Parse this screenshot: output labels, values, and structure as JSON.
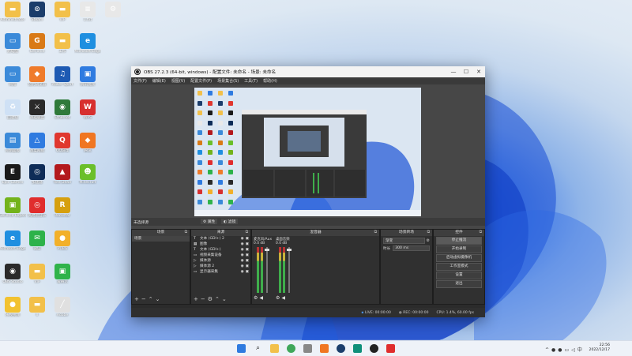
{
  "desktop": {
    "icons": [
      {
        "label": "Administrator",
        "color": "#f2c04a",
        "glyph": "▬"
      },
      {
        "label": "Steam",
        "color": "#1b3d6b",
        "glyph": "⊙"
      },
      {
        "label": "VIP",
        "color": "#f2c04a",
        "glyph": "▬"
      },
      {
        "label": "1.txt",
        "color": "#e8e8e8",
        "glyph": "≡"
      },
      {
        "label": "",
        "color": "#e8e8e8",
        "glyph": "⚙"
      },
      {
        "label": "此电脑",
        "color": "#3b8ad9",
        "glyph": "▭"
      },
      {
        "label": "GeForce",
        "color": "#d97a17",
        "glyph": "G"
      },
      {
        "label": "工作",
        "color": "#f2c04a",
        "glyph": "▬"
      },
      {
        "label": "Microsoft Edge",
        "color": "#1f8fe0",
        "glyph": "e"
      },
      {
        "label": "网络",
        "color": "#3b8ad9",
        "glyph": "▭"
      },
      {
        "label": "猎豹浏览器",
        "color": "#ef7b2b",
        "glyph": "◆"
      },
      {
        "label": "Power Sport",
        "color": "#1d5ab3",
        "glyph": "♫"
      },
      {
        "label": "腾讯视频",
        "color": "#2f7be0",
        "glyph": "▣"
      },
      {
        "label": "回收站",
        "color": "#cfe1f5",
        "glyph": "♻"
      },
      {
        "label": "英雄联盟",
        "color": "#2a2a2a",
        "glyph": "⚔"
      },
      {
        "label": "Ethernet",
        "color": "#2f7a3a",
        "glyph": "◉"
      },
      {
        "label": "WPS",
        "color": "#d7302f",
        "glyph": "W"
      },
      {
        "label": "控制面板",
        "color": "#3b8ad9",
        "glyph": "▤"
      },
      {
        "label": "百度网盘",
        "color": "#2f7be0",
        "glyph": "△"
      },
      {
        "label": "QQ游戏",
        "color": "#e0372f",
        "glyph": "Q"
      },
      {
        "label": "腾讯",
        "color": "#f07622",
        "glyph": "◆"
      },
      {
        "label": "Epic Games",
        "color": "#1a1a1a",
        "glyph": "E"
      },
      {
        "label": "加速器",
        "color": "#0e2c57",
        "glyph": "◎"
      },
      {
        "label": "Red Dead",
        "color": "#b3191d",
        "glyph": "▲"
      },
      {
        "label": "Minecraft",
        "color": "#6bbf2a",
        "glyph": "☻"
      },
      {
        "label": "GeForce Experience",
        "color": "#73b31b",
        "glyph": "▣"
      },
      {
        "label": "网易云音乐",
        "color": "#e02d2d",
        "glyph": "◎"
      },
      {
        "label": "Rockstar",
        "color": "#d6a00f",
        "glyph": "R"
      },
      {
        "label": "Microsoft Edge",
        "color": "#1f8fe0",
        "glyph": "e"
      },
      {
        "label": "微信",
        "color": "#2db24a",
        "glyph": "✉"
      },
      {
        "label": "PUBG",
        "color": "#f2b02a",
        "glyph": "●"
      },
      {
        "label": "OBS Studio",
        "color": "#2a2a2a",
        "glyph": "◉"
      },
      {
        "label": "VIP",
        "color": "#f2c04a",
        "glyph": "▬"
      },
      {
        "label": "爱奇艺",
        "color": "#2fb34a",
        "glyph": "▣"
      },
      {
        "label": "乐视视频",
        "color": "#f2c230",
        "glyph": "●"
      },
      {
        "label": "II",
        "color": "#f2c04a",
        "glyph": "▬"
      },
      {
        "label": "Adobe",
        "color": "#e0e0e0",
        "glyph": "╱"
      }
    ]
  },
  "window": {
    "title": "OBS 27.2.3 (64-bit, windows) - 配置文件: 未命名 - 场景: 未命名",
    "menu": [
      "文件(F)",
      "编辑(E)",
      "视图(V)",
      "配置文件(P)",
      "场景集合(S)",
      "工具(T)",
      "帮助(H)"
    ],
    "minimize": "—",
    "maximize": "☐",
    "close": "✕"
  },
  "controls_strip": {
    "left": "未选择源",
    "props": "属性",
    "filters": "滤镜"
  },
  "docks": {
    "scenes": {
      "header": "场景",
      "items": [
        "场景"
      ]
    },
    "sources": {
      "header": "来源",
      "items": [
        {
          "label": "文本 (GDI+) 2",
          "icon": "T"
        },
        {
          "label": "图像",
          "icon": "▦"
        },
        {
          "label": "文本 (GDI+)",
          "icon": "T"
        },
        {
          "label": "视频采集设备",
          "icon": "▭"
        },
        {
          "label": "媒体源",
          "icon": "▷"
        },
        {
          "label": "媒体源 2",
          "icon": "▷"
        },
        {
          "label": "显示器采集",
          "icon": "▭"
        }
      ]
    },
    "mixer": {
      "header": "混音器",
      "channels": [
        {
          "name": "麦克风/Aux",
          "db": "0.0 dB"
        },
        {
          "name": "桌面音频",
          "db": "0.0 dB"
        }
      ]
    },
    "transitions": {
      "header": "场景转场",
      "type": "渐变",
      "duration_label": "时长",
      "duration": "300 ms"
    },
    "controls": {
      "header": "控件",
      "buttons": [
        "停止推流",
        "开始录制",
        "启动虚拟摄像机",
        "工作室模式",
        "设置",
        "退出"
      ]
    }
  },
  "status": {
    "live": "LIVE: 00:00:00",
    "rec": "REC: 00:00:00",
    "cpu": "CPU: 1.4%, 60.00 fps"
  },
  "tray": {
    "time": "22:56",
    "date": "2022/12/17"
  }
}
